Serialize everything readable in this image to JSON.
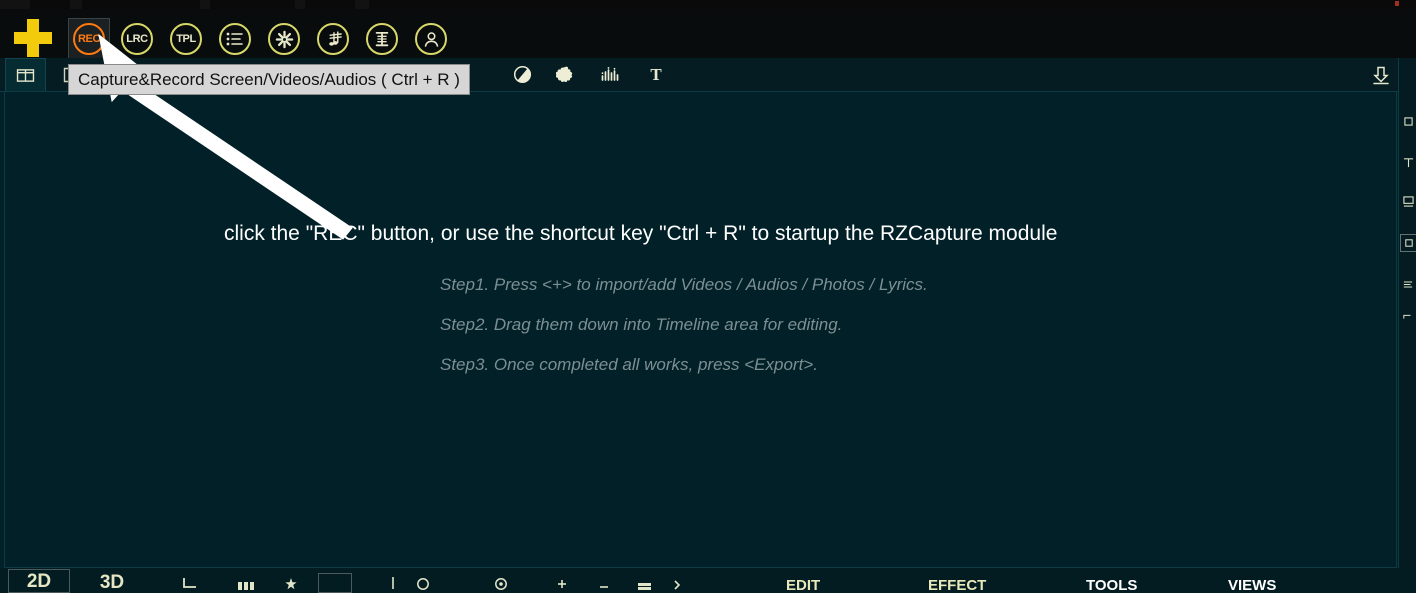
{
  "app": {
    "canvas_bg": "#022027",
    "toolbar_bg": "#090c0d",
    "accent_yellow": "#f2cc0c",
    "accent_orange": "#ff7a10",
    "icon_outline": "#d8d86a"
  },
  "toolbar": {
    "add_button_label": "+",
    "buttons": [
      {
        "label": "REC",
        "name": "rec-button",
        "kind": "text",
        "color": "#ff7a10",
        "active": true
      },
      {
        "label": "LRC",
        "name": "lrc-button",
        "kind": "text",
        "color": "#d8d86a",
        "active": false
      },
      {
        "label": "TPL",
        "name": "tpl-button",
        "kind": "text",
        "color": "#d8d86a",
        "active": false
      },
      {
        "label": "",
        "name": "playlist-icon",
        "kind": "list",
        "color": "#d8d86a",
        "active": false
      },
      {
        "label": "",
        "name": "effects-asterisk-icon",
        "kind": "asterisk",
        "color": "#d8d86a",
        "active": false
      },
      {
        "label": "",
        "name": "music-note-icon",
        "kind": "note",
        "color": "#d8d86a",
        "active": false
      },
      {
        "label": "",
        "name": "text-title-icon",
        "kind": "title",
        "color": "#d8d86a",
        "active": false
      },
      {
        "label": "",
        "name": "user-account-icon",
        "kind": "user",
        "color": "#d8d86a",
        "active": false
      }
    ]
  },
  "tooltip": {
    "text": "Capture&Record Screen/Videos/Audios ( Ctrl + R )"
  },
  "tabrow": {
    "tabs": [
      {
        "name": "tab-layout",
        "glyph": "layout",
        "active": true
      },
      {
        "name": "tab-document",
        "glyph": "doc",
        "active": false
      }
    ],
    "tools": [
      {
        "name": "color-wheel-icon",
        "glyph": "wheel"
      },
      {
        "name": "sticker-icon",
        "glyph": "star"
      },
      {
        "name": "equalizer-icon",
        "glyph": "equalizer"
      },
      {
        "name": "text-tool-icon",
        "glyph": "T"
      }
    ],
    "import_icon": "download-arrow-icon"
  },
  "canvas": {
    "annotation": "click the \"REC\" button, or use the shortcut key \"Ctrl + R\" to startup the RZCapture module",
    "steps": [
      "Step1. Press <+> to import/add Videos / Audios / Photos / Lyrics.",
      "Step2. Drag them down into Timeline area for editing.",
      "Step3. Once completed all works, press <Export>."
    ]
  },
  "right_rail": {
    "items": [
      {
        "name": "rail-item-layers",
        "glyph": "▫"
      },
      {
        "name": "rail-item-panel",
        "glyph": "⊤"
      },
      {
        "name": "rail-item-frame",
        "glyph": "▄"
      },
      {
        "name": "rail-item-selected",
        "glyph": "▢",
        "selected": true
      },
      {
        "name": "rail-item-list",
        "glyph": "≡"
      },
      {
        "name": "rail-item-more",
        "glyph": "⌐"
      }
    ]
  },
  "bottombar": {
    "view_buttons": [
      {
        "name": "view-2d-button",
        "label": "2D",
        "framed": true
      },
      {
        "name": "view-3d-button",
        "label": "3D",
        "framed": false
      }
    ],
    "icons": [
      {
        "name": "crop-icon",
        "glyph": "⌐"
      },
      {
        "name": "grid-icon",
        "glyph": "▮▮▮"
      },
      {
        "name": "pin-icon",
        "glyph": "✦"
      },
      {
        "name": "frame-box-icon",
        "glyph": ""
      },
      {
        "name": "divider-icon",
        "glyph": "|"
      },
      {
        "name": "zoom-out-icon",
        "glyph": "◯"
      },
      {
        "name": "zoom-in-icon",
        "glyph": "◉"
      },
      {
        "name": "plus-small-icon",
        "glyph": "+"
      },
      {
        "name": "minus-small-icon",
        "glyph": "−"
      },
      {
        "name": "bars-icon",
        "glyph": "≡"
      },
      {
        "name": "play-icon",
        "glyph": "›"
      }
    ],
    "menus": [
      {
        "name": "menu-edit",
        "label": "EDIT",
        "color": "#e8e8b8"
      },
      {
        "name": "menu-effect",
        "label": "EFFECT",
        "color": "#e8e8b8"
      },
      {
        "name": "menu-tools",
        "label": "TOOLS",
        "color": "#ffffff"
      },
      {
        "name": "menu-views",
        "label": "VIEWS",
        "color": "#ffffff"
      }
    ]
  }
}
